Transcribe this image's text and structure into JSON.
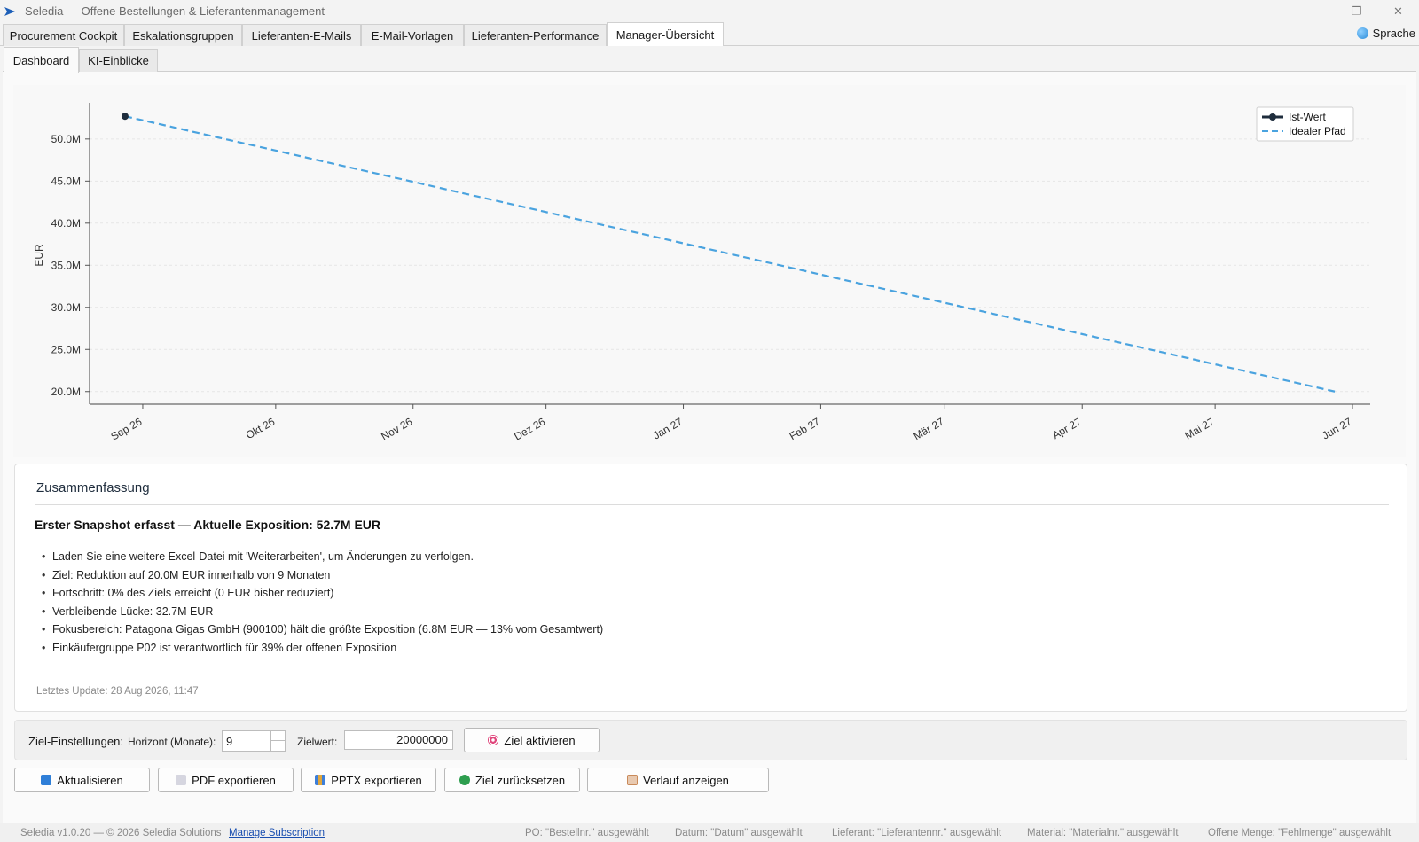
{
  "window": {
    "title": "Seledia — Offene Bestellungen & Lieferantenmanagement",
    "controls": {
      "minimize": "—",
      "restore": "❐",
      "close": "✕"
    }
  },
  "main_tabs": [
    {
      "label": "Procurement Cockpit"
    },
    {
      "label": "Eskalationsgruppen"
    },
    {
      "label": "Lieferanten-E-Mails"
    },
    {
      "label": "E-Mail-Vorlagen"
    },
    {
      "label": "Lieferanten-Performance"
    },
    {
      "label": "Manager-Übersicht",
      "active": true
    }
  ],
  "language_button": "Sprache",
  "sub_tabs": [
    {
      "label": "Dashboard",
      "active": true
    },
    {
      "label": "KI-Einblicke"
    }
  ],
  "chart_data": {
    "type": "line",
    "title": "",
    "xlabel": "",
    "ylabel": "EUR",
    "x_ticks": [
      "Sep 26",
      "Okt 26",
      "Nov 26",
      "Dez 26",
      "Jan 27",
      "Feb 27",
      "Mär 27",
      "Apr 27",
      "Mai 27",
      "Jun 27"
    ],
    "y_ticks": [
      "20.0M",
      "25.0M",
      "30.0M",
      "35.0M",
      "40.0M",
      "45.0M",
      "50.0M"
    ],
    "ylim": [
      18.5,
      54.3
    ],
    "xlim": [
      "2026-08-20",
      "2027-06-05"
    ],
    "grid": "horizontal",
    "legend_position": "top-right",
    "series": [
      {
        "name": "Ist-Wert",
        "style": "solid-marker",
        "color": "#1f2d3d",
        "points": [
          {
            "x": "2026-08-28",
            "y": 52.7
          }
        ]
      },
      {
        "name": "Idealer Pfad",
        "style": "dashed",
        "color": "#4aa3df",
        "points": [
          {
            "x": "2026-08-28",
            "y": 52.7
          },
          {
            "x": "2027-05-28",
            "y": 20.0
          }
        ]
      }
    ]
  },
  "summary": {
    "title": "Zusammenfassung",
    "headline": "Erster Snapshot erfasst — Aktuelle Exposition: 52.7M EUR",
    "bullets": [
      "Laden Sie eine weitere Excel-Datei mit 'Weiterarbeiten', um Änderungen zu verfolgen.",
      "Ziel: Reduktion auf 20.0M EUR innerhalb von 9 Monaten",
      "Fortschritt: 0% des Ziels erreicht (0 EUR bisher reduziert)",
      "Verbleibende Lücke: 32.7M EUR",
      "Fokusbereich: Patagona Gigas GmbH (900100) hält die größte Exposition (6.8M EUR — 13% vom Gesamtwert)",
      "Einkäufergruppe P02 ist verantwortlich für 39% der offenen Exposition"
    ],
    "last_update": "Letztes Update: 28 Aug 2026, 11:47"
  },
  "goal_settings": {
    "label": "Ziel-Einstellungen:",
    "horizon_label": "Horizont (Monate):",
    "horizon_value": "9",
    "target_label": "Zielwert:",
    "target_value": "20000000",
    "activate_button": "Ziel aktivieren"
  },
  "actions": [
    {
      "label": "Aktualisieren",
      "icon": "refresh-icon",
      "color": "#2f7fd8"
    },
    {
      "label": "PDF exportieren",
      "icon": "pdf-icon",
      "color": "#c9c9d6"
    },
    {
      "label": "PPTX exportieren",
      "icon": "pptx-chart-icon",
      "color": "#3d7fd9"
    },
    {
      "label": "Ziel zurücksetzen",
      "icon": "recycle-icon",
      "color": "#2e9e4f"
    },
    {
      "label": "Verlauf anzeigen",
      "icon": "clipboard-icon",
      "color": "#c98a5a"
    }
  ],
  "status_bar": {
    "version": "Seledia v1.0.20 — © 2026 Seledia Solutions",
    "manage_link": "Manage Subscription",
    "po": "PO: \"Bestellnr.\" ausgewählt",
    "date": "Datum: \"Datum\" ausgewählt",
    "supplier": "Lieferant: \"Lieferantennr.\" ausgewählt",
    "material": "Material: \"Materialnr.\" ausgewählt",
    "open_qty": "Offene Menge: \"Fehlmenge\" ausgewählt"
  }
}
